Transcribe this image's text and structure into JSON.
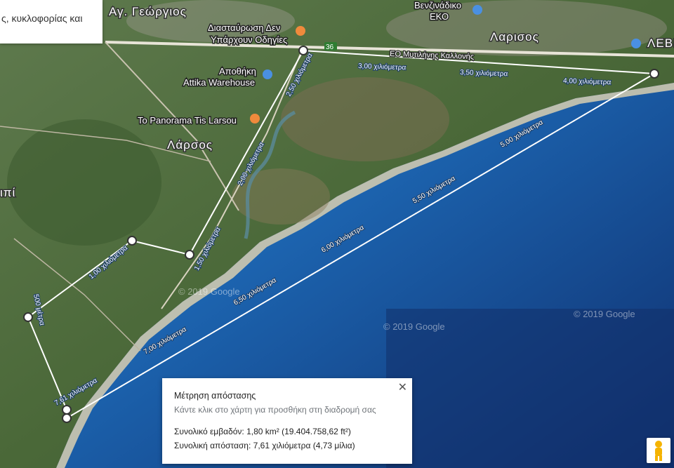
{
  "search": {
    "text": "ς, κυκλοφορίας και"
  },
  "places": {
    "ag_georgios": "Αγ. Γεώργιος",
    "larsos_west": "Λάρσος",
    "larsos_east": "Λαρισος",
    "leven": "ΛΕΒΕΝ",
    "partial_west": "ιπί"
  },
  "pois": {
    "intersection_1": "Διασταύρωση Δεν",
    "intersection_2": "Υπάρχουν Οδηγίες",
    "warehouse_1": "Αποθήκη",
    "warehouse_2": "Attika Warehouse",
    "panorama": "To Panorama Tis Larsou",
    "gas_1": "Βενζινάδικο",
    "gas_2": "ΕΚΟ"
  },
  "roads": {
    "highway": "ΕΟ Μυτιλήνης Καλλονής",
    "route": "36"
  },
  "measure_ticks": [
    "1,00 χιλιόμετρα",
    "1,50 χιλιόμετρα",
    "2,00 χιλιόμετρα",
    "2,50 χιλιόμετρα",
    "3,00 χιλιόμετρα",
    "3,50 χιλιόμετρα",
    "4,00 χιλιόμετρα",
    "5,00 χιλιόμετρα",
    "5,50 χιλιόμετρα",
    "6,00 χιλιόμετρα",
    "6,50 χιλιόμετρα",
    "7,00 χιλιόμετρα",
    "500 μέτρα",
    "7,61 χιλιόμετρα"
  ],
  "copyrights": [
    "© 2019 Google",
    "© 2019 Google",
    "© 2019 Google"
  ],
  "measure_card": {
    "title": "Μέτρηση απόστασης",
    "hint": "Κάντε κλικ στο χάρτη για προσθήκη στη διαδρομή σας",
    "area": "Συνολικό εμβαδόν: 1,80 km² (19.404.758,62 ft²)",
    "distance": "Συνολική απόσταση: 7,61 χιλιόμετρα (4,73 μίλια)",
    "close": "✕"
  },
  "colors": {
    "sea_deep": "#123f86",
    "sea_shallow": "#2a8fd0",
    "land": "#4d6b3a",
    "measure_line": "#ffffff",
    "pin_orange": "#f08a3c",
    "pin_blue": "#4a90e2",
    "pegman": "#f5b301"
  },
  "icons": {
    "close": "close-icon",
    "pegman": "pegman-icon",
    "poi_food": "restaurant-pin-icon",
    "poi_store": "store-pin-icon",
    "poi_gas": "gas-station-pin-icon"
  }
}
